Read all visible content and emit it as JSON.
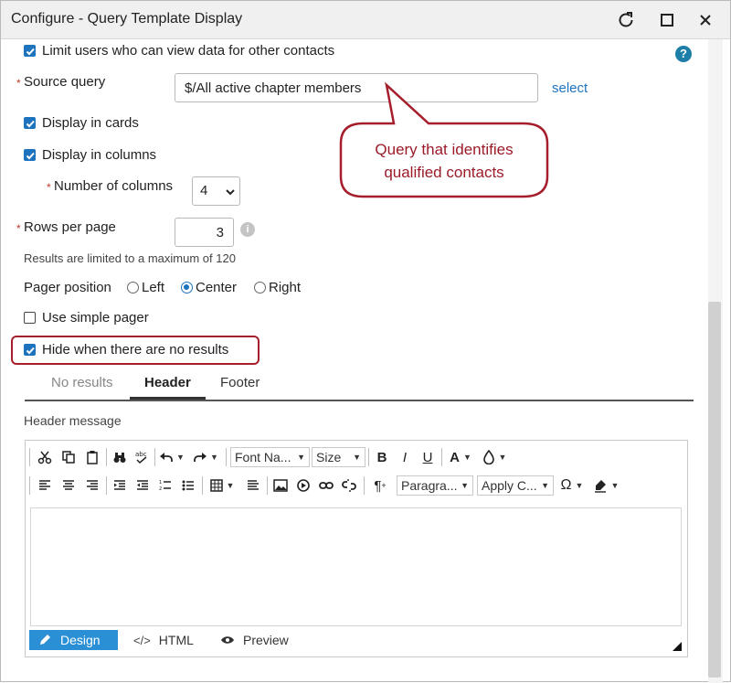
{
  "window": {
    "title": "Configure - Query Template Display"
  },
  "form": {
    "limit_users_label": "Limit users who can view data for other contacts",
    "source_query_label": "Source query",
    "source_query_value": "$/All active chapter members",
    "select_link": "select",
    "display_cards_label": "Display in cards",
    "display_columns_label": "Display in columns",
    "num_columns_label": "Number of columns",
    "num_columns_value": "4",
    "rows_per_page_label": "Rows per page",
    "rows_per_page_value": "3",
    "rows_hint": "Results are limited to a maximum of 120",
    "pager_position_label": "Pager position",
    "pager_options": [
      "Left",
      "Center",
      "Right"
    ],
    "pager_selected": "Center",
    "simple_pager_label": "Use simple pager",
    "hide_no_results_label": "Hide when there are no results",
    "required_mark": "*",
    "help_glyph": "?",
    "info_glyph": "i"
  },
  "callout": {
    "line1": "Query that identifies",
    "line2": "qualified contacts"
  },
  "tabs": [
    "No results",
    "Header",
    "Footer"
  ],
  "active_tab": "Header",
  "editor": {
    "message_label": "Header message",
    "font_name": "Font Na...",
    "size": "Size",
    "paragraph": "Paragra...",
    "apply_css": "Apply C...",
    "bold": "B",
    "italic": "I",
    "underline": "U",
    "font_color": "A",
    "omega": "Ω",
    "pilcrow": "¶",
    "modes": [
      "Design",
      "HTML",
      "Preview"
    ],
    "active_mode": "Design",
    "html_glyph": "</>"
  },
  "colors": {
    "accent": "#1e73be",
    "callout": "#9b1b28",
    "highlight": "#a61e2c",
    "design_tab": "#2b8fd6"
  }
}
